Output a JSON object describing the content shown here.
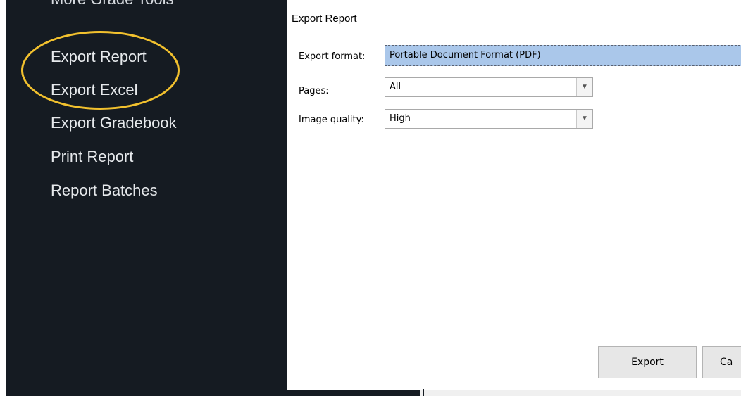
{
  "sidebar": {
    "top_item": "More Grade Tools",
    "items": [
      {
        "label": "Export Report"
      },
      {
        "label": "Export Excel"
      },
      {
        "label": "Export Gradebook"
      },
      {
        "label": "Print Report"
      },
      {
        "label": "Report Batches"
      }
    ],
    "highlight_color": "#f2c12e"
  },
  "dialog": {
    "title": "Export Report",
    "fields": {
      "format": {
        "label": "Export format:",
        "value": "Portable Document Format (PDF)"
      },
      "pages": {
        "label": "Pages:",
        "value": "All"
      },
      "quality": {
        "label": "Image quality:",
        "value": "High"
      }
    },
    "buttons": {
      "export": "Export",
      "cancel_partial": "Ca"
    }
  }
}
